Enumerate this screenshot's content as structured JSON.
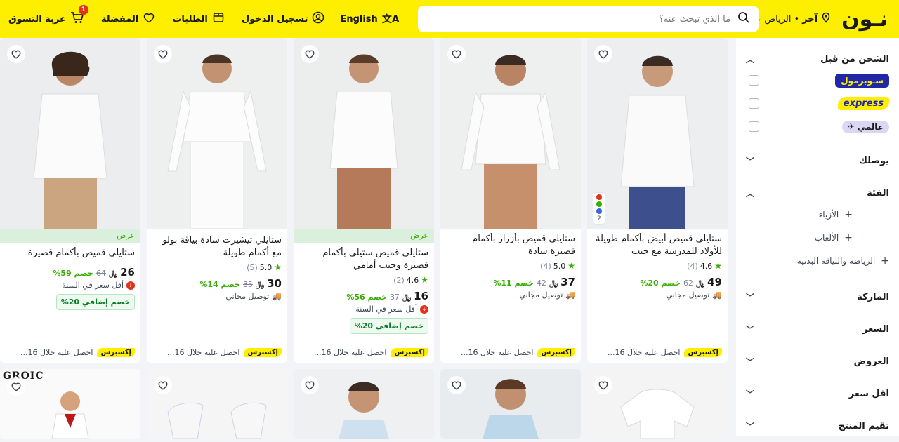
{
  "header": {
    "logo_text": "نـون",
    "location_label": "آخر",
    "location_city": "الرياض",
    "search_placeholder": "ما الذي تبحث عنه؟",
    "lang_label": "English",
    "login_label": "تسجيل الدخول",
    "orders_label": "الطلبات",
    "wishlist_label": "المفضلة",
    "cart_label": "عربة التسوق",
    "cart_count": "1"
  },
  "sidebar": {
    "shipped_title": "الشحن من قبل",
    "shipped_options": [
      {
        "label": "سـوبرمول"
      },
      {
        "label": "express"
      },
      {
        "label": "عالمي"
      }
    ],
    "delivery_title": "يوصلك",
    "category_title": "الفئة",
    "categories": [
      "الأزياء",
      "الألعاب",
      "الرياضة واللياقة البدنية"
    ],
    "brand_title": "الماركة",
    "price_title": "السعر",
    "offers_title": "العروض",
    "lowest_title": "اقل سعر",
    "rating_title": "تقيم المنتج"
  },
  "products": [
    {
      "title": "ستايلي قميص أبيض بأكمام طويلة للأولاد للمدرسة مع جيب",
      "rating": "4.6",
      "reviews": "(4)",
      "price": "49",
      "was": "62",
      "discount": "خصم 20%",
      "note": "توصيل مجاني",
      "express": "إكسبرس",
      "delivery": "احصل عليه خلال 16...",
      "color_count": "2",
      "offer_label": "",
      "extra": ""
    },
    {
      "title": "ستايلي قميص بأزرار بأكمام قصيرة سادة",
      "rating": "5.0",
      "reviews": "(4)",
      "price": "37",
      "was": "42",
      "discount": "خصم 11%",
      "note": "توصيل مجاني",
      "express": "إكسبرس",
      "delivery": "احصل عليه خلال 16...",
      "offer_label": "",
      "extra": ""
    },
    {
      "title": "ستايلي قميص ستيلي بأكمام قصيرة وجيب أمامي",
      "rating": "4.6",
      "reviews": "(2)",
      "price": "16",
      "was": "37",
      "discount": "خصم 56%",
      "note": "أقل سعر في السنة",
      "express": "إكسبرس",
      "delivery": "احصل عليه خلال 16...",
      "offer_label": "عرض",
      "extra": "خصم إضافي 20%"
    },
    {
      "title": "ستايلي تيشيرت سادة بياقة بولو مع أكمام طويلة",
      "rating": "5.0",
      "reviews": "(5)",
      "price": "30",
      "was": "35",
      "discount": "خصم 14%",
      "note": "توصيل مجاني",
      "express": "إكسبرس",
      "delivery": "احصل عليه خلال 16...",
      "offer_label": "",
      "extra": ""
    },
    {
      "title": "ستايلى قميص بأكمام قصيرة",
      "rating": "",
      "reviews": "",
      "price": "26",
      "was": "64",
      "discount": "خصم 59%",
      "note": "أقل سعر في السنة",
      "express": "إكسبرس",
      "delivery": "احصل عليه خلال 16...",
      "offer_label": "عرض",
      "extra": "خصم إضافي 20%"
    }
  ],
  "row2_brand": "GROIC"
}
